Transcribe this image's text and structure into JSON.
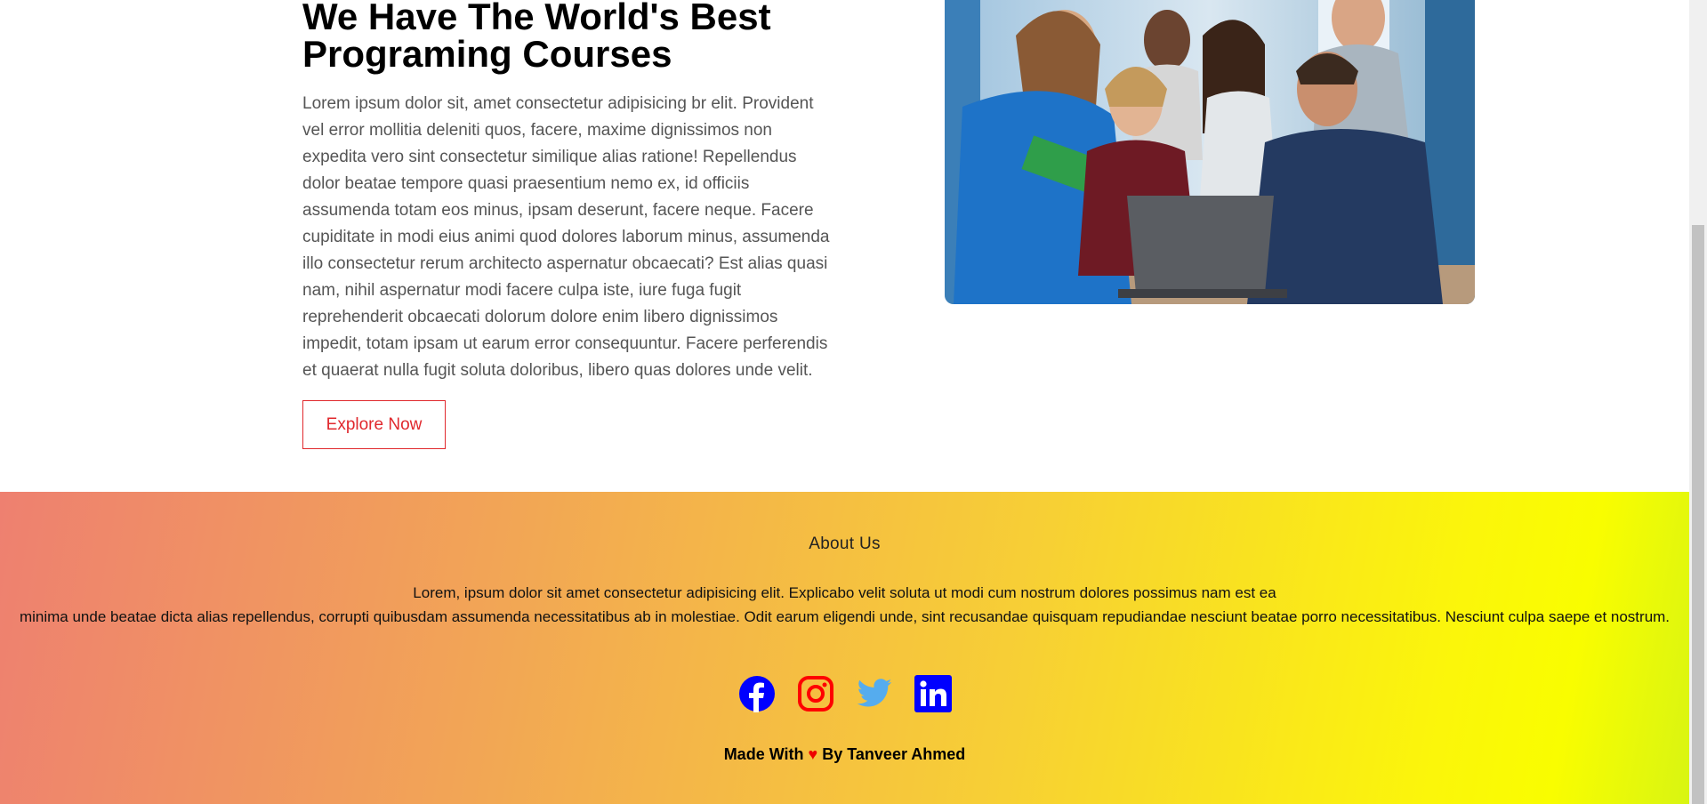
{
  "hero": {
    "title_line1": "We Have The World's Best",
    "title_line2": "Programing Courses",
    "paragraph": "Lorem ipsum dolor sit, amet consectetur adipisicing br elit. Provident vel error mollitia deleniti quos, facere, maxime dignissimos non expedita vero sint consectetur similique alias ratione! Repellendus dolor beatae tempore quasi praesentium nemo ex, id officiis assumenda totam eos minus, ipsam deserunt, facere neque. Facere cupiditate in modi eius animi quod dolores laborum minus, assumenda illo consectetur rerum architecto aspernatur obcaecati? Est alias quasi nam, nihil aspernatur modi facere culpa iste, iure fuga fugit reprehenderit obcaecati dolorum dolore enim libero dignissimos impedit, totam ipsam ut earum error consequuntur. Facere perferendis et quaerat nulla fugit soluta doloribus, libero quas dolores unde velit.",
    "button_label": "Explore Now"
  },
  "footer": {
    "title": "About Us",
    "text_line1": "Lorem, ipsum dolor sit amet consectetur adipisicing elit. Explicabo velit soluta ut modi cum nostrum dolores possimus nam est ea",
    "text_line2": "minima unde beatae dicta alias repellendus, corrupti quibusdam assumenda necessitatibus ab in molestiae. Odit earum eligendi unde, sint recusandae quisquam repudiandae nesciunt beatae porro necessitatibus. Nesciunt culpa saepe et nostrum.",
    "social": [
      {
        "name": "facebook-icon",
        "color": "#0000ff"
      },
      {
        "name": "instagram-icon",
        "color": "#ff0000"
      },
      {
        "name": "twitter-icon",
        "color": "#55acee"
      },
      {
        "name": "linkedin-icon",
        "color": "#0000ff"
      }
    ],
    "made_with_prefix": "Made With",
    "heart": "♥",
    "made_with_suffix": "By Tanveer Ahmed"
  },
  "colors": {
    "accent": "#e0282d",
    "gradient_start": "#ee8070",
    "gradient_end": "#f9fd00"
  }
}
